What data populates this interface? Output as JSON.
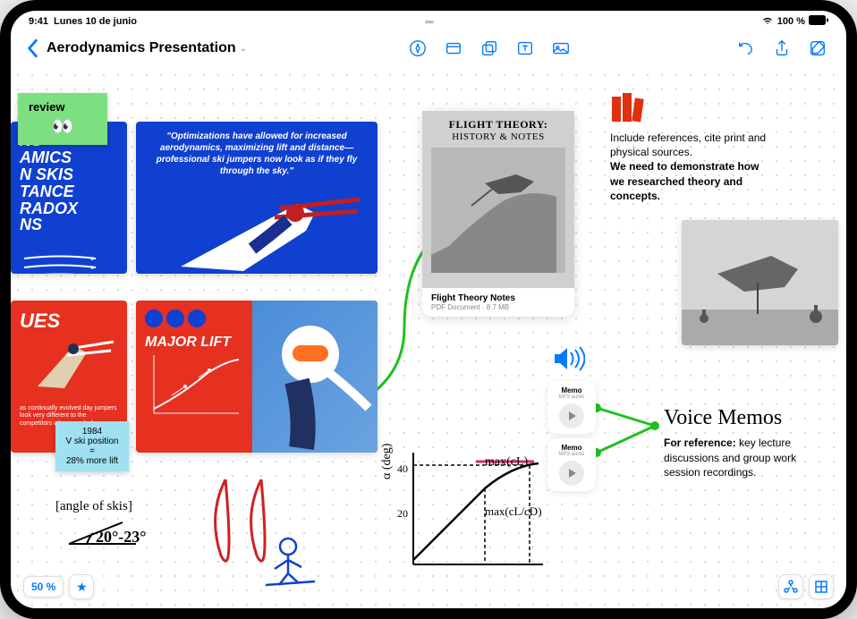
{
  "status": {
    "time": "9:41",
    "date": "Lunes 10 de junio",
    "battery": "100 %"
  },
  "toolbar": {
    "doc_title": "Aerodynamics Presentation"
  },
  "stickies": {
    "review": "review",
    "ski_note_line1": "1984",
    "ski_note_line2": "V ski position",
    "ski_note_line3": "=",
    "ski_note_line4": "28% more lift"
  },
  "slides": {
    "blue1_l1": "NS",
    "blue1_l2": "AMICS",
    "blue1_l3": "N SKIS",
    "blue1_l4": "TANCE",
    "blue1_l5": "RADOX",
    "blue1_l6": "NS",
    "blue2_quote": "\"Optimizations have allowed for increased aerodynamics, maximizing lift and distance—professional ski jumpers now look as if they fly through the sky.\"",
    "red1_title": "UES",
    "red1_body": "as continually evolved day jumpers look very different to the competitors who came before",
    "red2_title": "MAJOR LIFT"
  },
  "file": {
    "title": "FLIGHT THEORY:",
    "subtitle": "HISTORY & NOTES",
    "name": "Flight Theory Notes",
    "meta": "PDF Document · 8.7 MB"
  },
  "notes": {
    "ref_l1": "Include references, cite print and physical sources.",
    "ref_l2": "We need to demonstrate how we researched theory and concepts.",
    "voice_title": "Voice Memos",
    "voice_l1": "For reference:",
    "voice_l2": "key lecture discussions and group work session recordings."
  },
  "memos": {
    "memo1_name": "Memo",
    "memo1_meta": "MP3 audio",
    "memo2_name": "Memo",
    "memo2_meta": "MP3 audio"
  },
  "handwriting": {
    "angle_label": "[angle of skis]",
    "angle_value": "20°-23°",
    "maxcl": "max(cL)",
    "maxclcd": "max(cL/cD)",
    "yaxis": "α (deg)",
    "y40": "40",
    "y20": "20"
  },
  "zoom": {
    "level": "50 %"
  }
}
